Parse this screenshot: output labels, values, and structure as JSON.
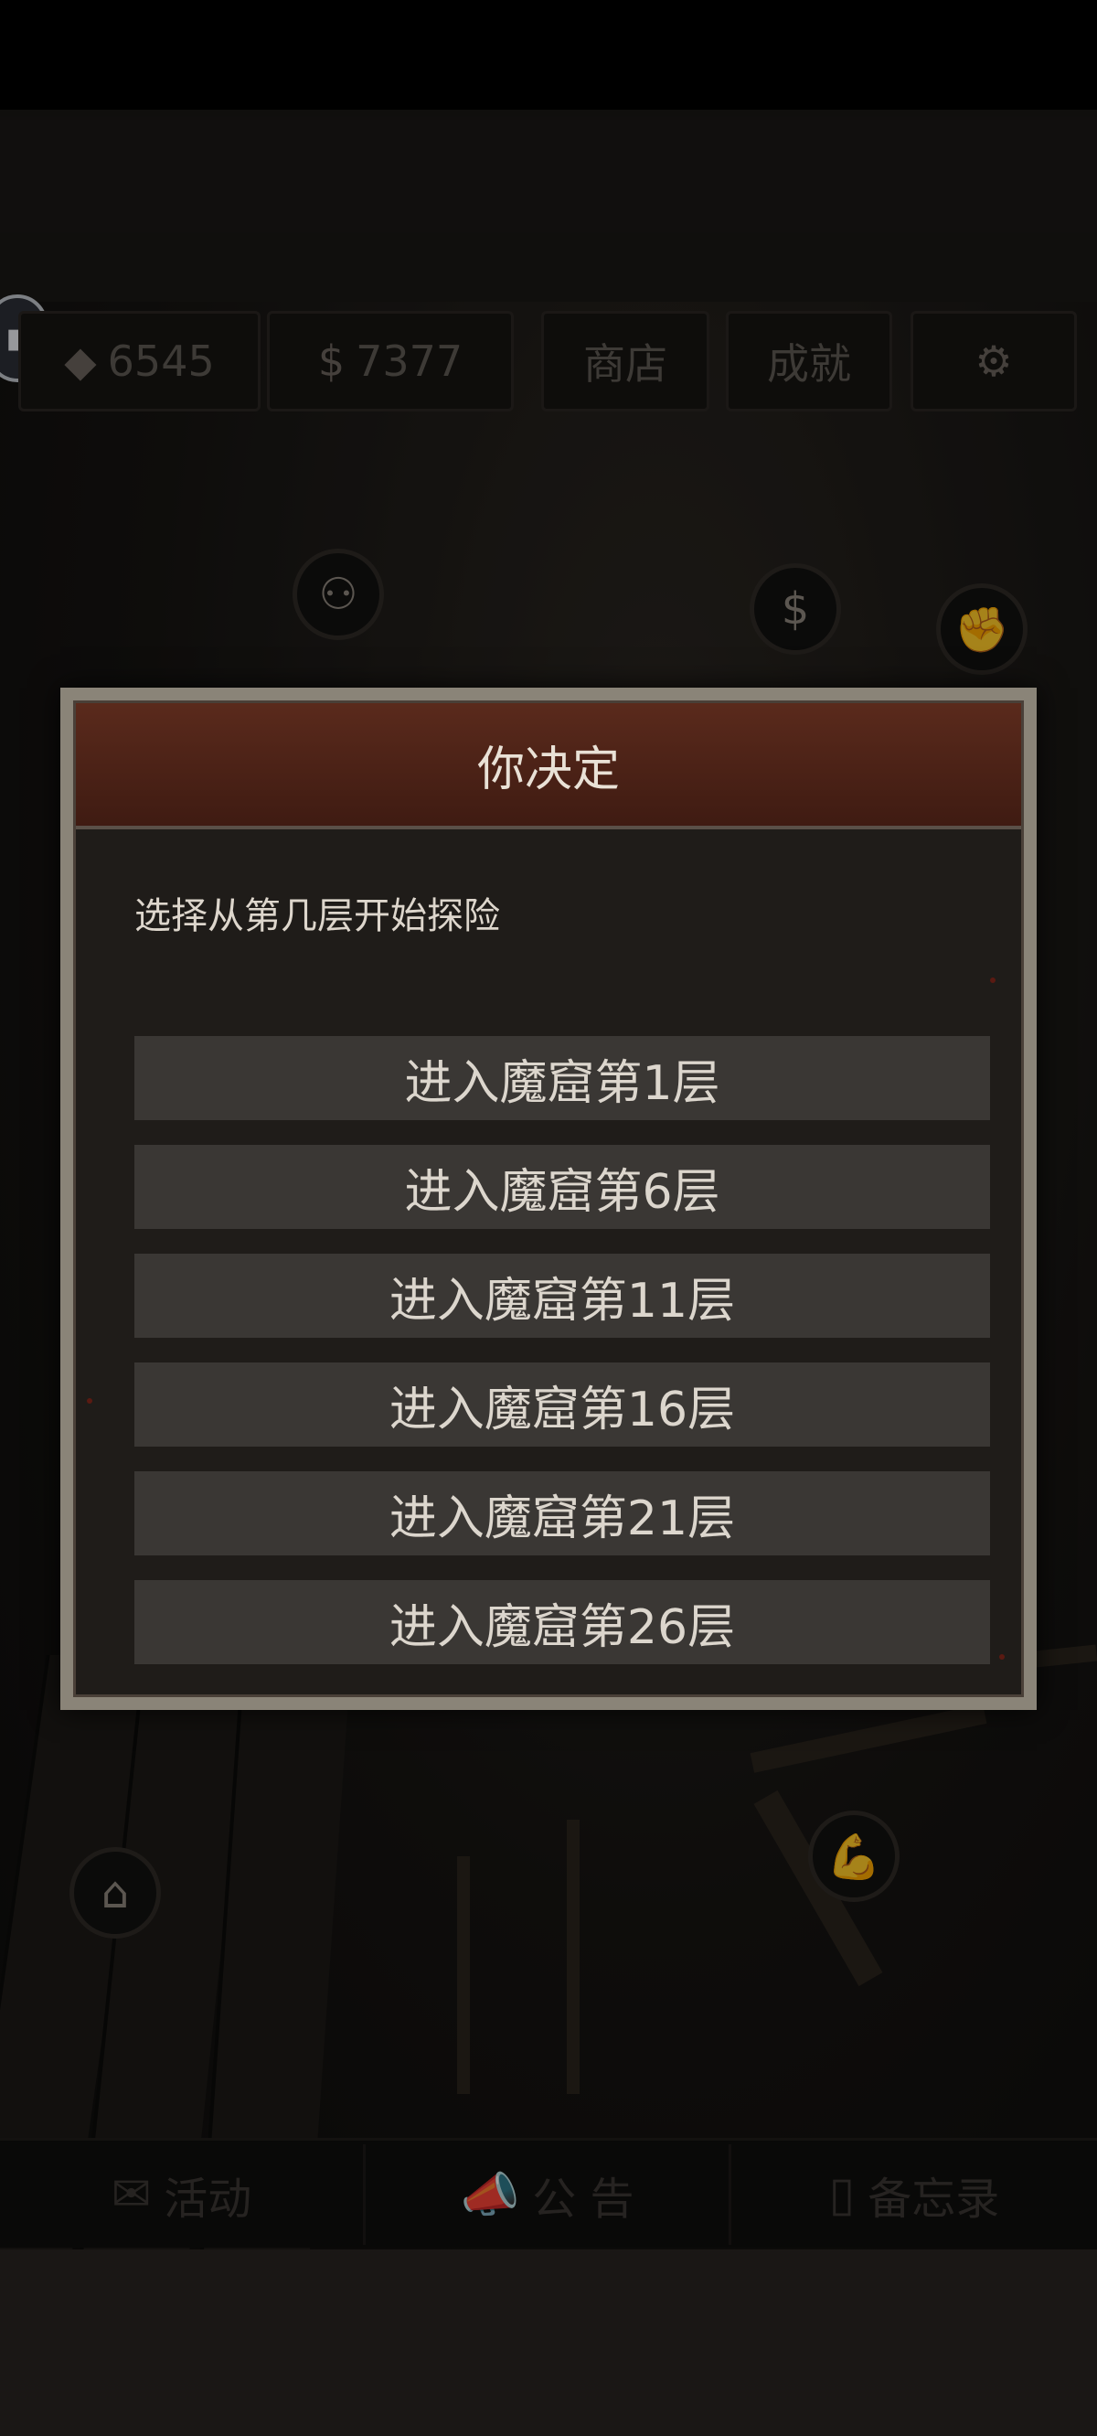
{
  "hud": {
    "gems": "6545",
    "coins": "7377",
    "shop_label": "商店",
    "achievements_label": "成就",
    "gem_icon": "gem-icon",
    "coin_icon": "dollar-icon",
    "settings_icon": "gear-icon"
  },
  "dialog": {
    "title": "你决定",
    "message": "选择从第几层开始探险",
    "options": [
      "进入魔窟第1层",
      "进入魔窟第6层",
      "进入魔窟第11层",
      "进入魔窟第16层",
      "进入魔窟第21层",
      "进入魔窟第26层"
    ]
  },
  "tabs": {
    "events_label": "活动",
    "notice_label": "公 告",
    "memo_label": "备忘录"
  },
  "colors": {
    "dialog_header": "#4a2216",
    "dialog_body": "#1f1c19",
    "option_bg": "#3a3734",
    "frame": "#8a8478"
  }
}
